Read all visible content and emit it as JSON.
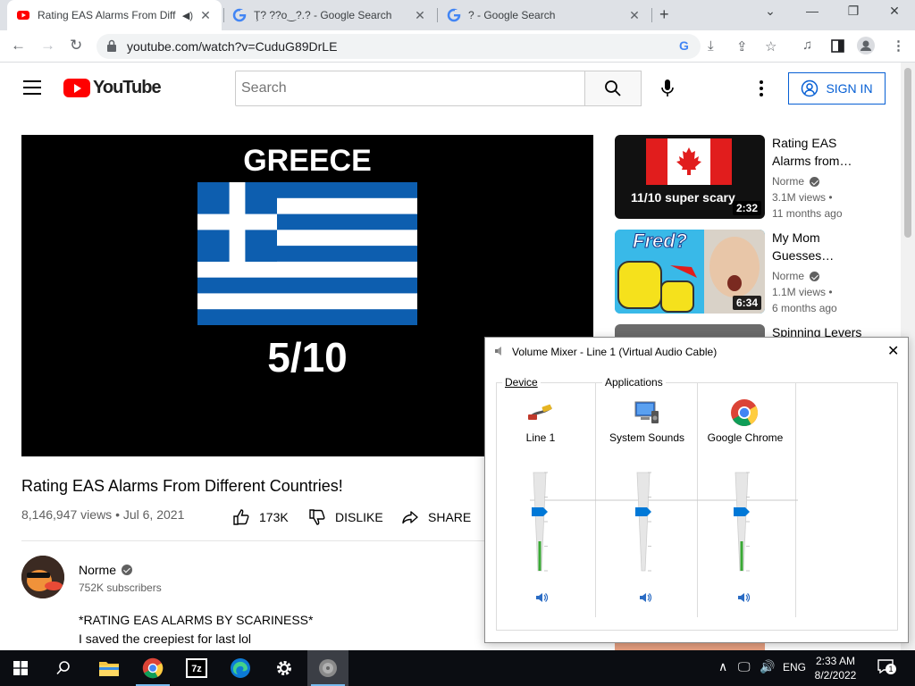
{
  "browser": {
    "tabs": [
      {
        "title": "Rating EAS Alarms From Diff",
        "close": "✕",
        "audio": "speaker-icon"
      },
      {
        "title": "Ţ? ??ο‿?.? - Google Search",
        "close": "✕"
      },
      {
        "title": "? - Google Search",
        "close": "✕"
      }
    ],
    "new_tab": "+",
    "window_controls": {
      "tabsearch": "⌄",
      "minimize": "—",
      "maximize": "❐",
      "close": "✕"
    },
    "url": "youtube.com/watch?v=CuduG89DrLE"
  },
  "youtube": {
    "logo_text": "YouTube",
    "search_placeholder": "Search",
    "sign_in": "SIGN IN",
    "video": {
      "overlay_title": "GREECE",
      "overlay_score": "5/10",
      "title": "Rating EAS Alarms From Different Countries!",
      "meta": "8,146,947 views • Jul 6, 2021",
      "likes": "173K",
      "dislike": "DISLIKE",
      "share": "SHARE"
    },
    "channel": {
      "name": "Norme",
      "subscribers": "752K subscribers",
      "description_line1": "*RATING EAS ALARMS BY SCARINESS*",
      "description_line2": "I saved the creepiest for last lol"
    },
    "related": [
      {
        "title_l1": "Rating EAS",
        "title_l2": "Alarms from…",
        "channel": "Norme",
        "views": "3.1M views •",
        "age": "11 months ago",
        "duration": "2:32",
        "thumb_text": "11/10 super scary"
      },
      {
        "title_l1": "My Mom",
        "title_l2": "Guesses…",
        "channel": "Norme",
        "views": "1.1M views •",
        "age": "6 months ago",
        "duration": "6:34",
        "thumb_text": "Fred?"
      },
      {
        "title_l1": "Spinning Levers"
      }
    ]
  },
  "mixer": {
    "title": "Volume Mixer - Line 1 (Virtual Audio Cable)",
    "close": "✕",
    "device_label": "Device",
    "apps_label": "Applications",
    "channels": [
      {
        "name": "Line 1",
        "level": 0.6,
        "peak": 0.3
      },
      {
        "name": "System Sounds",
        "level": 0.6,
        "peak": 0
      },
      {
        "name": "Google Chrome",
        "level": 0.6,
        "peak": 0.3
      }
    ]
  },
  "taskbar": {
    "tray_lang": "ENG",
    "time": "2:33 AM",
    "date": "8/2/2022",
    "notifications": "1"
  },
  "colors": {
    "yt_red": "#ff0000",
    "link_blue": "#065fd4",
    "slider_blue": "#0078d7",
    "meter_green": "#3aa935"
  }
}
